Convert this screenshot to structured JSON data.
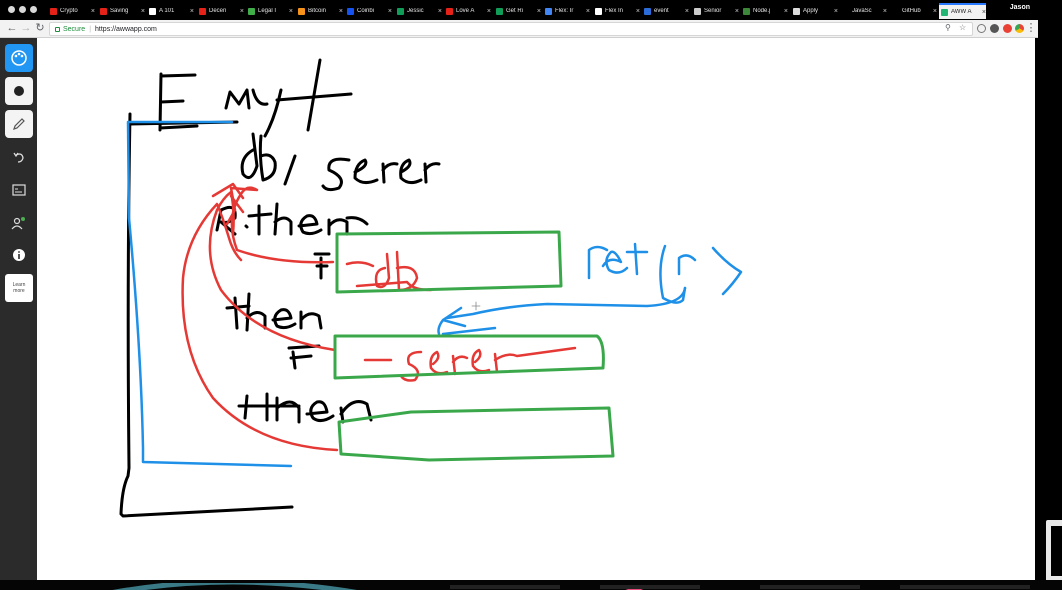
{
  "browser": {
    "tabs": [
      {
        "title": "Crypto",
        "favicon_color": "#e62117"
      },
      {
        "title": "Saving",
        "favicon_color": "#e62117"
      },
      {
        "title": "A 101",
        "favicon_color": "#ffffff"
      },
      {
        "title": "Decen",
        "favicon_color": "#e62117"
      },
      {
        "title": "Legal I",
        "favicon_color": "#3fae49"
      },
      {
        "title": "Bitcoin",
        "favicon_color": "#f7931a"
      },
      {
        "title": "Coinbi",
        "favicon_color": "#1652f0"
      },
      {
        "title": "Jessic",
        "favicon_color": "#0f9d58"
      },
      {
        "title": "Love A",
        "favicon_color": "#e62117"
      },
      {
        "title": "Get Ri",
        "favicon_color": "#0f9d58"
      },
      {
        "title": "Flex: Ir",
        "favicon_color": "#4285f4"
      },
      {
        "title": "Flex In",
        "favicon_color": "#ffffff"
      },
      {
        "title": "event",
        "favicon_color": "#2b6cd8"
      },
      {
        "title": "Senior",
        "favicon_color": "#cccccc"
      },
      {
        "title": "Node.j",
        "favicon_color": "#3c873a"
      },
      {
        "title": "Apply",
        "favicon_color": "#dddddd"
      },
      {
        "title": "JavaSc",
        "favicon_color": "#000000"
      },
      {
        "title": "GitHub",
        "favicon_color": "#000000"
      },
      {
        "title": "AWW A",
        "favicon_color": "#22b573",
        "active": true
      }
    ],
    "user": "Jason",
    "url": "https://awwapp.com",
    "secure_label": "Secure",
    "separator": "|"
  },
  "toolbar": {
    "tools": [
      "palette-icon",
      "brush-dot-icon",
      "pencil-icon",
      "undo-icon",
      "board-icon",
      "users-icon",
      "info-icon"
    ],
    "learn_label_1": "Learn",
    "learn_label_2": "more"
  },
  "whiteboard": {
    "handwriting": [
      "E Myt",
      "db / Serer",
      "R.then",
      "F",
      "_db",
      "ret ( r )",
      "then",
      "F",
      "_serer",
      "then"
    ],
    "colors": {
      "ink": "#000000",
      "blue": "#1e90e8",
      "red": "#e53935",
      "green": "#3aa84a"
    }
  }
}
